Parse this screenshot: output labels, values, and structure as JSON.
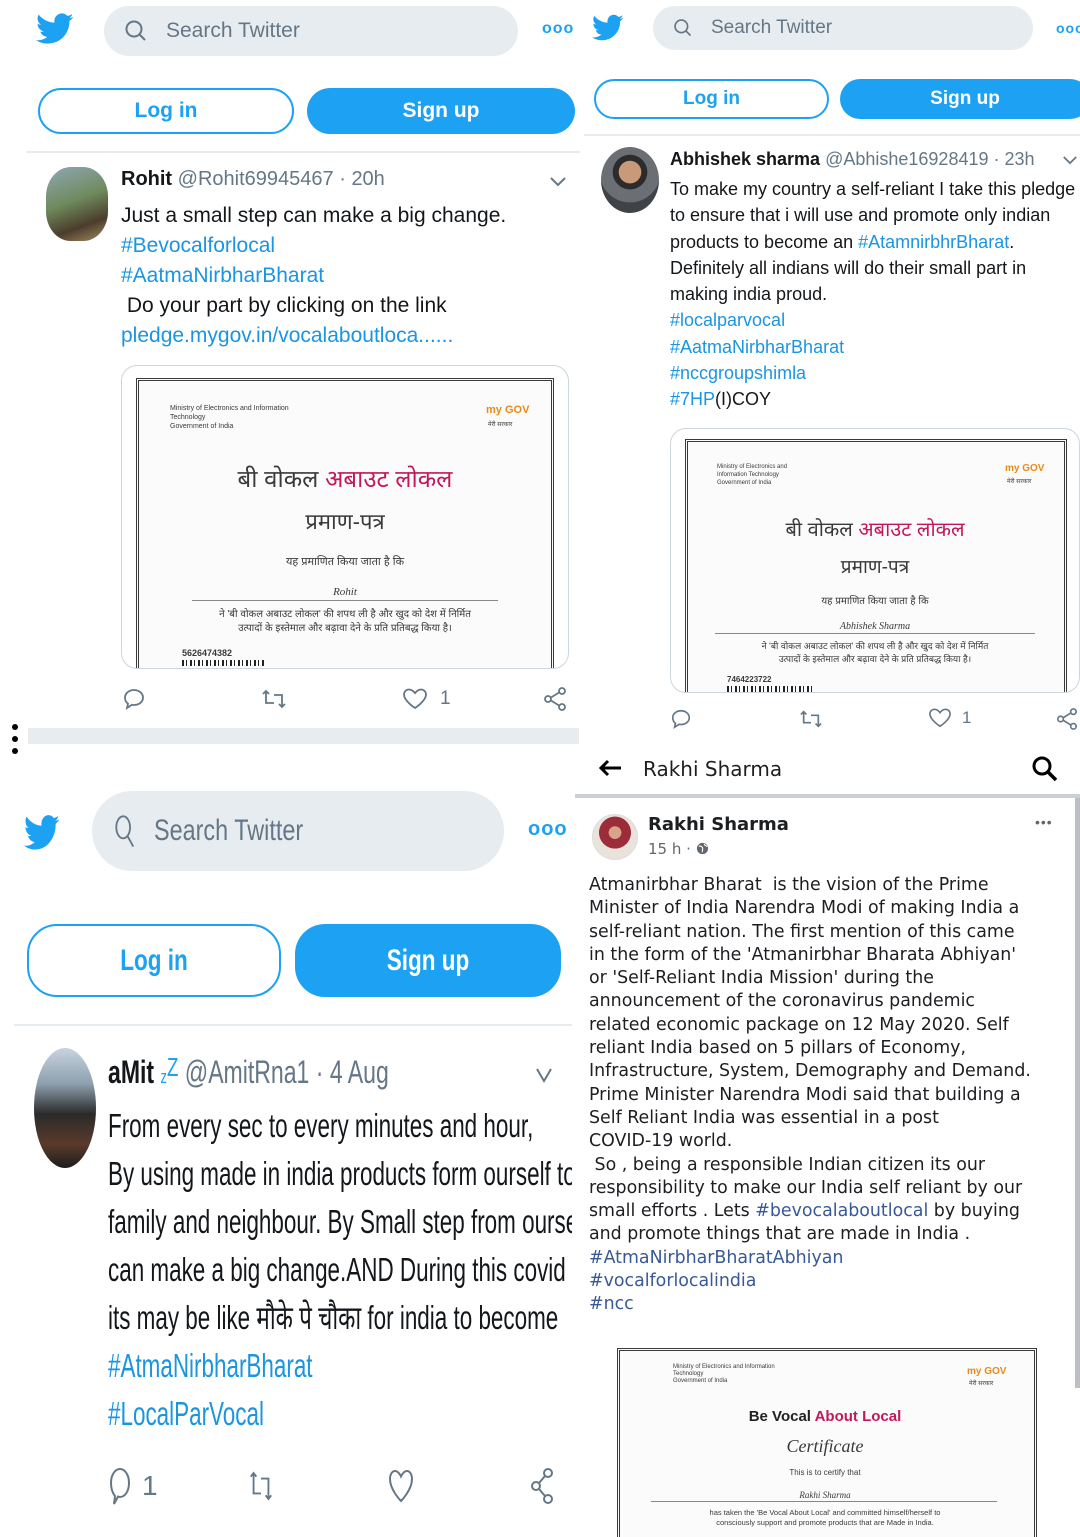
{
  "twitter": {
    "search_placeholder": "Search Twitter",
    "more": "ooo",
    "login_label": "Log in",
    "signup_label": "Sign up",
    "brand_color": "#1da1f2"
  },
  "tweet1": {
    "name": "Rohit",
    "handle": "@Rohit69945467",
    "sep": "·",
    "time": "20h",
    "line1": "Just a small step can make a big change.",
    "tag1": "#Bevocalforlocal",
    "tag2": "#AatmaNirbharBharat",
    "line2": " Do your part by clicking on the link",
    "link": "pledge.mygov.in/vocalaboutloca......",
    "likes": "1",
    "cert": {
      "ministry": "Ministry of Electronics and Information Technology",
      "govt": "Government of India",
      "logo": "my GOV",
      "logo_sub": "मेरी सरकार",
      "title_a": "बी वोकल",
      "title_b": "अबाउट लोकल",
      "subtitle": "प्रमाण-पत्र",
      "certify": "यह प्रमाणित किया जाता है कि",
      "signer": "Rohit",
      "pledge1": "ने 'बी वोकल अबाउट लोकल' की शपथ ली है और खुद को देश में निर्मित",
      "pledge2": "उत्पादों के इस्तेमाल और बढ़ावा देने के प्रति प्रतिबद्ध किया है।",
      "number": "5626474382"
    }
  },
  "tweet2": {
    "name": "Abhishek sharma",
    "handle": "@Abhishe16928419",
    "sep": "·",
    "time": "23h",
    "l1": "To make my country a self-reliant I take this pledge",
    "l2": "to ensure that i will use and promote only indian",
    "l3a": "products to become an ",
    "l3tag": "#AtamnirbhrBharat",
    "l3b": ".",
    "l4": "Definitely all indians will do their small part in",
    "l5": "making india proud.",
    "tag1": "#localparvocal",
    "tag2": "#AatmaNirbharBharat",
    "tag3": "#nccgroupshimla",
    "tag4a": "#7HP",
    "tag4b": "(I)COY",
    "likes": "1",
    "cert": {
      "ministry": "Ministry of Electronics and Information Technology",
      "govt": "Government of India",
      "logo": "my GOV",
      "logo_sub": "मेरी सरकार",
      "title_a": "बी वोकल",
      "title_b": "अबाउट लोकल",
      "subtitle": "प्रमाण-पत्र",
      "certify": "यह प्रमाणित किया जाता है कि",
      "signer": "Abhishek Sharma",
      "pledge1": "ने 'बी वोकल अबाउट लोकल' की शपथ ली है और खुद को देश में निर्मित",
      "pledge2": "उत्पादों के इस्तेमाल और बढ़ावा देने के प्रति प्रतिबद्ध किया है।",
      "number": "7464223722"
    }
  },
  "tweet3": {
    "name": "aMit",
    "zz": "z",
    "zZ": "Z",
    "handle": "@AmitRna1",
    "sep": "·",
    "time": "4 Aug",
    "l1": "From every sec to every minutes and hour,",
    "l2": "By using made in india products form ourself to our",
    "l3": "family and neighbour. By Small step from ourself",
    "l4": "can make a big change.AND During this covid crises",
    "l5": "its may be like मौके पे चौका for india to become",
    "tag1": "#AtmaNirbharBharat",
    "tag2": "#LocalParVocal",
    "replies": "1"
  },
  "facebook": {
    "header_title": "Rakhi Sharma",
    "post_name": "Rakhi Sharma",
    "post_time": "15 h",
    "post_sep": "·",
    "more": "•••",
    "body": [
      "Atmanirbhar Bharat  is the vision of the Prime",
      "Minister of India Narendra Modi of making India a",
      "self-reliant nation. The first mention of this came",
      "in the form of the 'Atmanirbhar Bharata Abhiyan'",
      "or 'Self-Reliant India Mission' during the",
      "announcement of the coronavirus pandemic",
      "related economic package on 12 May 2020. Self",
      "reliant India based on 5 pillars of Economy,",
      "Infrastructure, System, Demography and Demand.",
      "Prime Minister Narendra Modi said that building a",
      "Self Reliant India was essential in a post",
      "COVID-19 world.",
      " So , being a responsible Indian citizen its our",
      "responsibility to make our India self reliant by our"
    ],
    "line15a": "small efforts . Lets ",
    "line15tag": "#bevocalaboutlocal",
    "line15b": " by buying",
    "line16": "and promote things that are made in India .",
    "tag1": "#AtmaNirbharBharatAbhiyan",
    "tag2": "#vocalforlocalindia",
    "tag3": "#ncc",
    "cert": {
      "ministry": "Ministry of Electronics and Information Technology",
      "govt": "Government of India",
      "logo": "my GOV",
      "logo_sub": "मेरी सरकार",
      "title_a": "Be Vocal",
      "title_b": "About Local",
      "subtitle": "Certificate",
      "certify": "This is to certify that",
      "signer": "Rakhi Sharma",
      "pledge1": "has taken the 'Be Vocal About Local' and committed himself/herself to",
      "pledge2": "consciously support and promote products that are Made in India."
    }
  }
}
